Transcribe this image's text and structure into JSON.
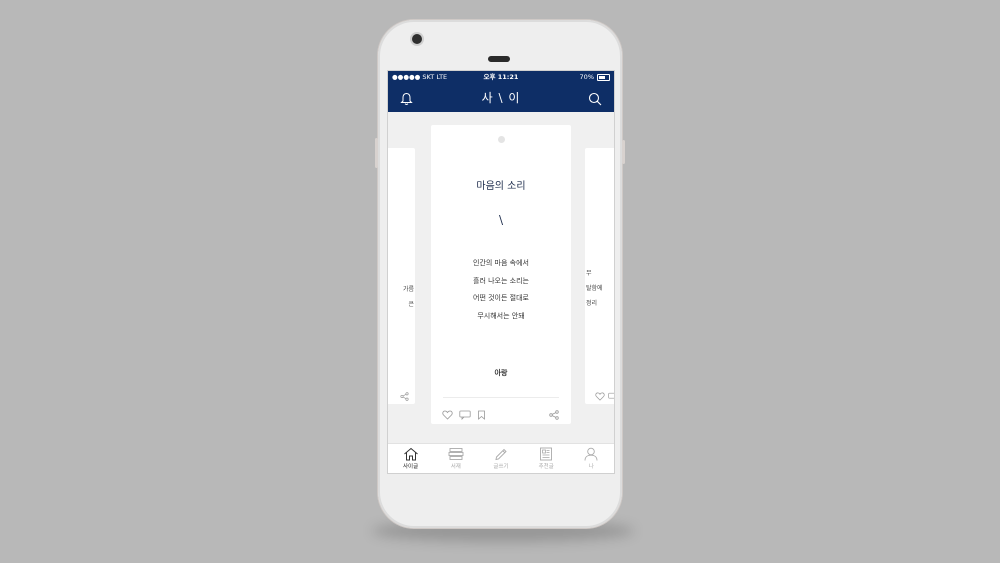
{
  "status_bar": {
    "carrier": "●●●●● SKT  LTE",
    "time": "오후 11:21",
    "battery_percent_text": "70%",
    "battery_level": 0.7
  },
  "app_bar": {
    "title": "사 \\ 이",
    "left_icon": "bell-icon",
    "right_icon": "search-icon"
  },
  "main_card": {
    "title": "마음의 소리",
    "divider_glyph": "\\",
    "lines": [
      "인간의 마음 속에서",
      "흘러 나오는 소리는",
      "어떤 것이든 절대로",
      "무시해서는 안돼"
    ],
    "author": "아랑",
    "actions": [
      "heart-icon",
      "comment-icon",
      "bookmark-icon",
      "share-icon"
    ]
  },
  "left_card": {
    "lines": [
      "가름",
      "은"
    ]
  },
  "right_card": {
    "lines": [
      "무",
      "탈함에",
      "정리"
    ]
  },
  "tabs": [
    {
      "label": "사이글",
      "icon": "home-icon",
      "active": true
    },
    {
      "label": "서재",
      "icon": "library-icon",
      "active": false
    },
    {
      "label": "글쓰기",
      "icon": "pencil-icon",
      "active": false
    },
    {
      "label": "추천글",
      "icon": "newspaper-icon",
      "active": false
    },
    {
      "label": "나",
      "icon": "user-icon",
      "active": false
    }
  ],
  "colors": {
    "header": "#0e2e66",
    "active_tab": "#222222",
    "inactive_tab": "#aaaaaa"
  }
}
